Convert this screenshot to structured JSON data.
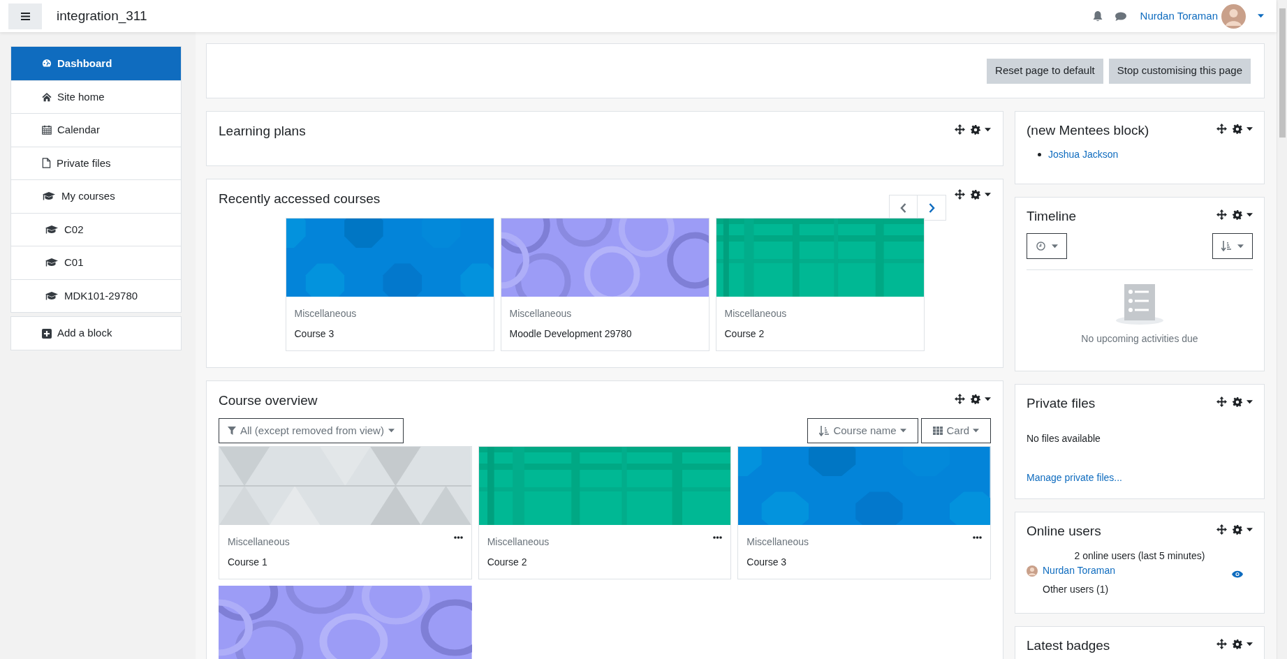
{
  "navbar": {
    "site_name": "integration_311",
    "user_name": "Nurdan Toraman"
  },
  "nav_drawer": {
    "items": [
      {
        "label": "Dashboard",
        "kind": "dashboard",
        "selected": true
      },
      {
        "label": "Site home",
        "kind": "home",
        "selected": false
      },
      {
        "label": "Calendar",
        "kind": "calendar",
        "selected": false
      },
      {
        "label": "Private files",
        "kind": "file",
        "selected": false
      },
      {
        "label": "My courses",
        "kind": "courses",
        "selected": false,
        "children": [
          {
            "label": "C02",
            "kind": "courses",
            "selected": false
          },
          {
            "label": "C01",
            "kind": "courses",
            "selected": false
          },
          {
            "label": "MDK101-29780",
            "kind": "courses",
            "selected": false
          }
        ]
      }
    ],
    "add_block": "Add a block"
  },
  "customise_buttons": [
    "Reset page to default",
    "Stop customising this page"
  ],
  "main_blocks": [
    {
      "kind": "empty",
      "title": "Learning plans"
    },
    {
      "kind": "recent",
      "title": "Recently accessed courses",
      "courses": [
        {
          "kind": "octagon",
          "category": "Miscellaneous",
          "name": "Course 3"
        },
        {
          "kind": "circle",
          "category": "Miscellaneous",
          "name": "Moodle Development 29780"
        },
        {
          "kind": "stripe",
          "category": "Miscellaneous",
          "name": "Course 2"
        }
      ]
    },
    {
      "kind": "overview",
      "title": "Course overview",
      "filter": "All (except removed from view)",
      "sort": "Course name",
      "view": "Card",
      "courses": [
        {
          "kind": "triangle",
          "category": "Miscellaneous",
          "name": "Course 1"
        },
        {
          "kind": "stripe",
          "category": "Miscellaneous",
          "name": "Course 2"
        },
        {
          "kind": "octagon",
          "category": "Miscellaneous",
          "name": "Course 3"
        },
        {
          "kind": "circle"
        }
      ]
    }
  ],
  "side_blocks": [
    {
      "kind": "mentees",
      "title": "(new Mentees block)",
      "links": [
        "Joshua Jackson"
      ]
    },
    {
      "kind": "timeline",
      "title": "Timeline",
      "empty_text": "No upcoming activities due"
    },
    {
      "kind": "files",
      "title": "Private files",
      "empty_text": "No files available",
      "link": "Manage private files..."
    },
    {
      "kind": "online",
      "title": "Online users",
      "summary": "2 online users (last 5 minutes)",
      "users": [
        {
          "name": "Nurdan Toraman",
          "visible": true
        }
      ],
      "other": "Other users (1)"
    },
    {
      "kind": "badges",
      "title": "Latest badges"
    }
  ]
}
